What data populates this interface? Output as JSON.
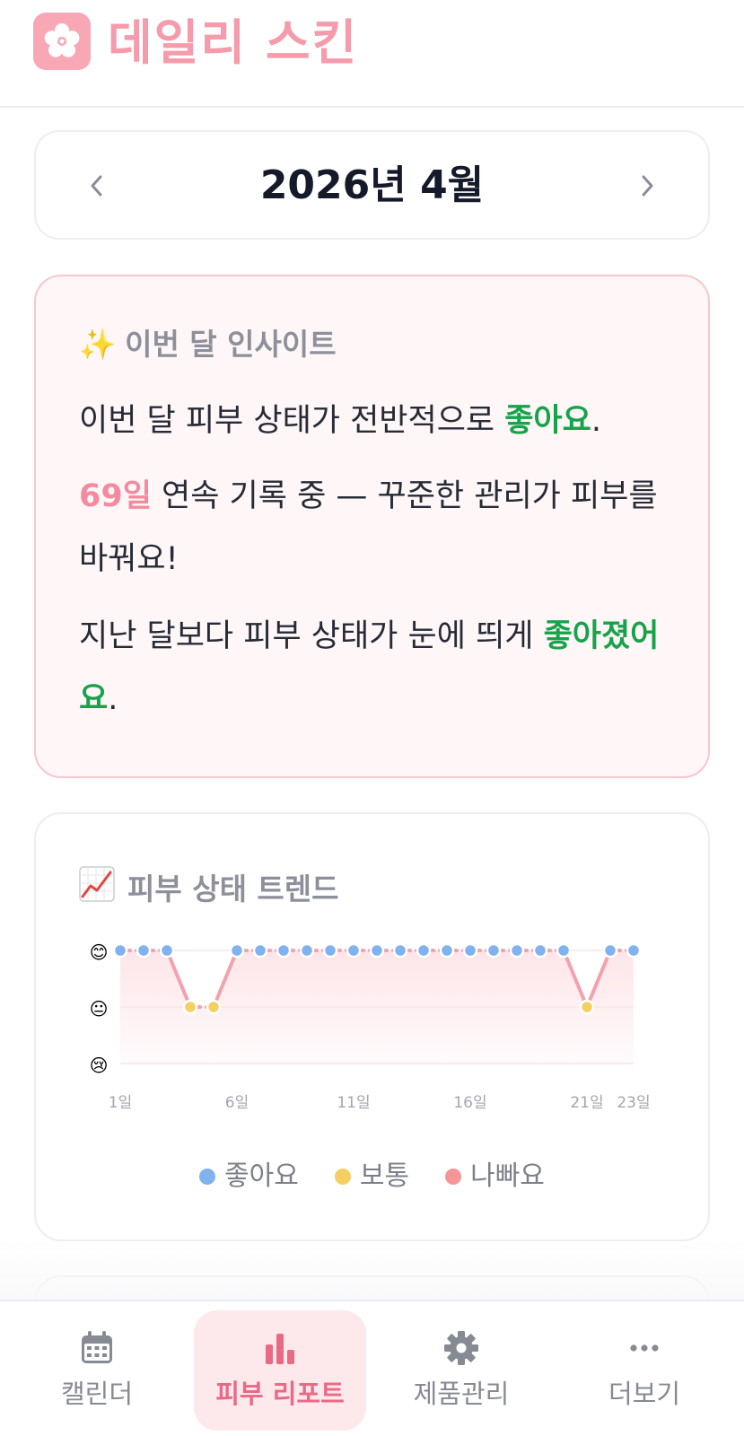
{
  "app": {
    "title": "데일리 스킨",
    "logo_icon": "cherry-blossom-icon",
    "brand_color": "#f59bab"
  },
  "month": {
    "label": "2026년 4월",
    "prev_icon": "chevron-left-icon",
    "next_icon": "chevron-right-icon"
  },
  "insight": {
    "title": "이번 달 인사이트",
    "icon": "sparkles-icon",
    "p1": {
      "a": "이번 달 피부 상태가 전반적으로 ",
      "b": "좋아요",
      "c": "."
    },
    "p2": {
      "a": "69일",
      "b": " 연속 기록 중 — 꾸준한 관리가 피부를 바꿔요!"
    },
    "p3": {
      "a": "지난 달보다 피부 상태가 눈에 띄게 ",
      "b": "좋아졌어요",
      "c": "."
    }
  },
  "trend": {
    "title": "피부 상태 트렌드",
    "icon": "chart-increasing-icon",
    "legend": [
      {
        "label": "좋아요",
        "color": "#7fb2ef"
      },
      {
        "label": "보통",
        "color": "#f6cf62"
      },
      {
        "label": "나빠요",
        "color": "#f59595"
      }
    ]
  },
  "chart_data": {
    "type": "line",
    "title": "피부 상태 트렌드",
    "x": [
      1,
      2,
      3,
      4,
      5,
      6,
      7,
      8,
      9,
      10,
      11,
      12,
      13,
      14,
      15,
      16,
      17,
      18,
      19,
      20,
      21,
      22,
      23
    ],
    "x_tick_labels": [
      "1일",
      "6일",
      "11일",
      "16일",
      "21일",
      "23일"
    ],
    "x_tick_values": [
      1,
      6,
      11,
      16,
      21,
      23
    ],
    "y_levels": [
      "😢",
      "😐",
      "😊"
    ],
    "y_range": [
      1,
      3
    ],
    "series": [
      {
        "values": [
          3,
          3,
          3,
          2,
          2,
          3,
          3,
          3,
          3,
          3,
          3,
          3,
          3,
          3,
          3,
          3,
          3,
          3,
          3,
          3,
          2,
          3,
          3
        ]
      }
    ],
    "point_colors": {
      "3": "#7fb2ef",
      "2": "#f6cf62",
      "1": "#f59595"
    },
    "line_color": "#f3a1ac",
    "grid": true,
    "legend_position": "bottom"
  },
  "nav": [
    {
      "label": "캘린더",
      "icon": "calendar-icon",
      "active": false
    },
    {
      "label": "피부 리포트",
      "icon": "bar-chart-icon",
      "active": true
    },
    {
      "label": "제품관리",
      "icon": "gear-icon",
      "active": false
    },
    {
      "label": "더보기",
      "icon": "more-dots-icon",
      "active": false
    }
  ]
}
